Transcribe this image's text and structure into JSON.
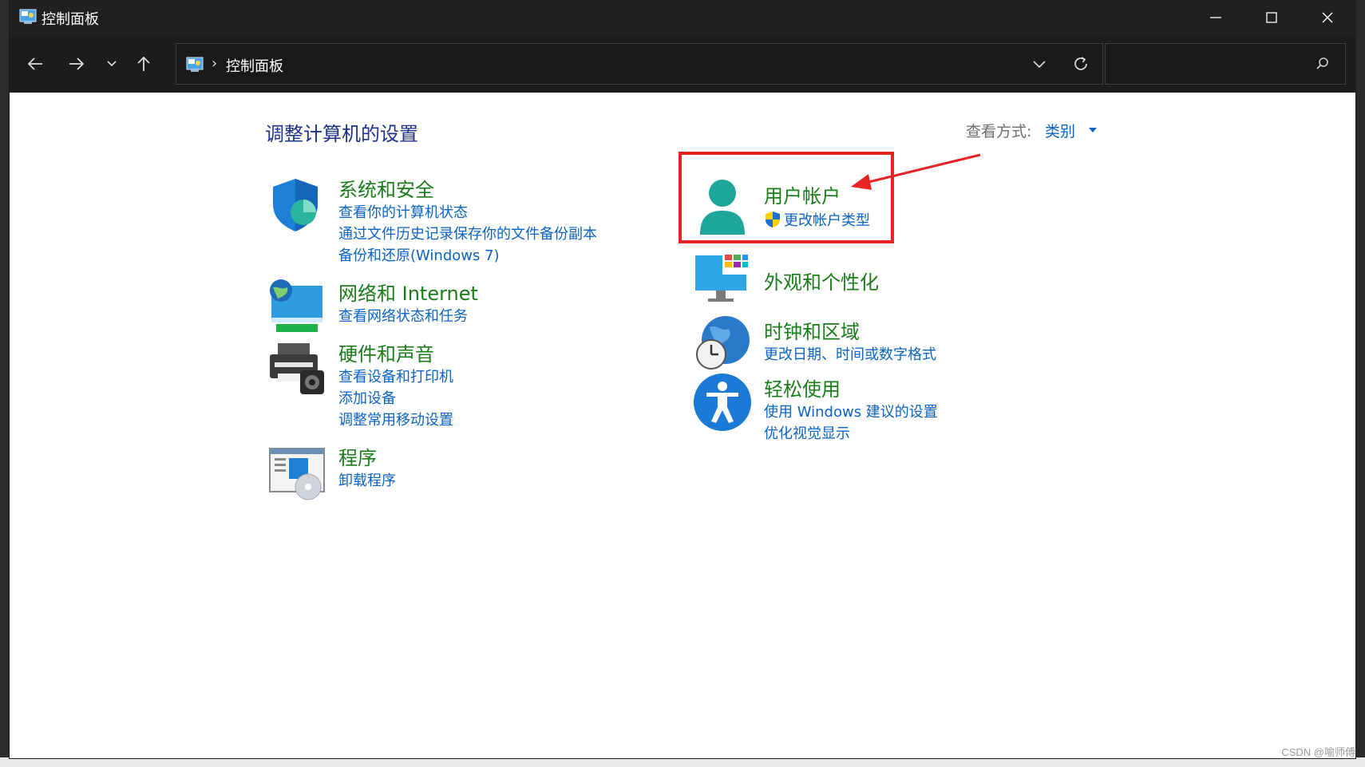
{
  "window": {
    "title": "控制面板"
  },
  "nav": {
    "address_text": "控制面板",
    "address_sep": "›",
    "search_placeholder": ""
  },
  "page": {
    "title": "调整计算机的设置",
    "view_by_label": "查看方式:",
    "view_by_value": "类别"
  },
  "categories": [
    {
      "title": "系统和安全",
      "links": [
        "查看你的计算机状态",
        "通过文件历史记录保存你的文件备份副本",
        "备份和还原(Windows 7)"
      ]
    },
    {
      "title": "网络和 Internet",
      "links": [
        "查看网络状态和任务"
      ]
    },
    {
      "title": "硬件和声音",
      "links": [
        "查看设备和打印机",
        "添加设备",
        "调整常用移动设置"
      ]
    },
    {
      "title": "程序",
      "links": [
        "卸载程序"
      ]
    },
    {
      "title": "用户帐户",
      "links": [
        "更改帐户类型"
      ]
    },
    {
      "title": "外观和个性化",
      "links": []
    },
    {
      "title": "时钟和区域",
      "links": [
        "更改日期、时间或数字格式"
      ]
    },
    {
      "title": "轻松使用",
      "links": [
        "使用 Windows 建议的设置",
        "优化视觉显示"
      ]
    }
  ],
  "watermark": "CSDN @喻师傅",
  "colors": {
    "title_blue": "#1e3287",
    "link_blue": "#0b63c5",
    "category_green": "#1a7d1a",
    "annotation_red": "#e82323"
  }
}
